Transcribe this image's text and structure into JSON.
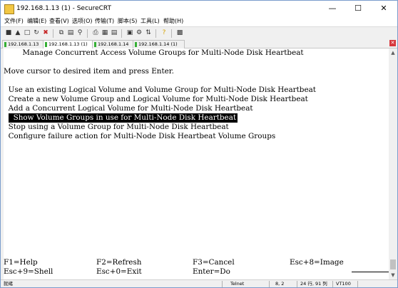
{
  "window": {
    "title": "192.168.1.13 (1) - SecureCRT",
    "controls": {
      "minimize": "—",
      "maximize": "☐",
      "close": "✕"
    }
  },
  "menu": [
    "文件(F)",
    "编辑(E)",
    "查看(V)",
    "选项(O)",
    "传输(T)",
    "脚本(S)",
    "工具(L)",
    "帮助(H)"
  ],
  "tabs": [
    {
      "label": "192.168.1.13"
    },
    {
      "label": "192.168.1.13 (1)"
    },
    {
      "label": "192.168.1.14"
    },
    {
      "label": "192.168.1.14 (1)"
    }
  ],
  "terminal": {
    "lines": [
      "        Manage Concurrent Access Volume Groups for Multi-Node Disk Heartbeat",
      "",
      "Move cursor to desired item and press Enter.",
      "",
      "  Use an existing Logical Volume and Volume Group for Multi-Node Disk Heartbeat",
      "  Create a new Volume Group and Logical Volume for Multi-Node Disk Heartbeat",
      "  Add a Concurrent Logical Volume for Multi-Node Disk Heartbeat",
      "  Show Volume Groups in use for Multi-Node Disk Heartbeat",
      "  Stop using a Volume Group for Multi-Node Disk Heartbeat",
      "  Configure failure action for Multi-Node Disk Heartbeat Volume Groups"
    ],
    "highlighted_index": 7,
    "function_keys": [
      [
        "F1=Help",
        "F2=Refresh",
        "F3=Cancel",
        "Esc+8=Image"
      ],
      [
        "Esc+9=Shell",
        "Esc+0=Exit",
        "Enter=Do",
        ""
      ]
    ]
  },
  "status": {
    "ready": "就绪",
    "protocol": "Telnet",
    "cursor": "8,  2",
    "size": "24 行, 91 列",
    "emulation": "VT100"
  }
}
